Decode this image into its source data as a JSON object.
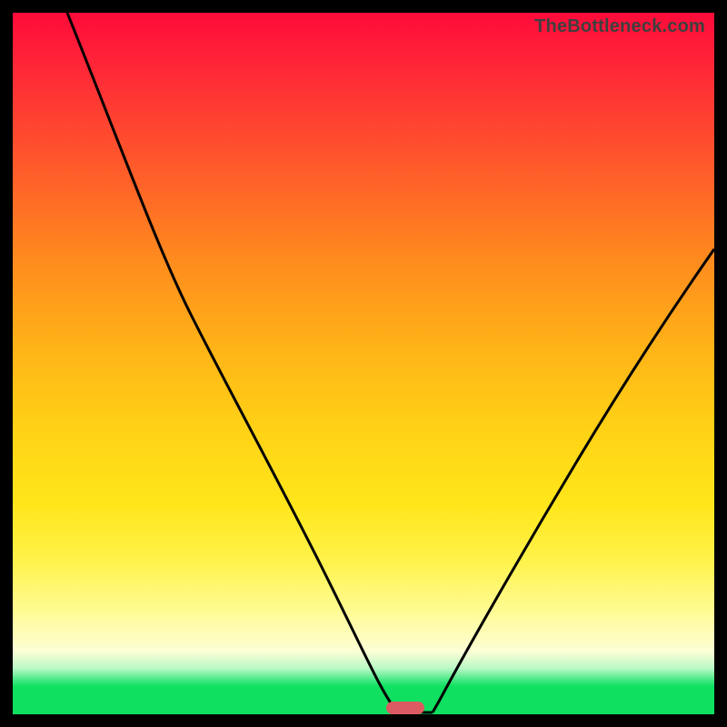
{
  "watermark": "TheBottleneck.com",
  "colors": {
    "frame": "#000000",
    "marker": "#dc5a61",
    "curve": "#000000"
  },
  "chart_data": {
    "type": "line",
    "title": "",
    "xlabel": "",
    "ylabel": "",
    "xlim": [
      0,
      100
    ],
    "ylim": [
      0,
      100
    ],
    "x": [
      0,
      5,
      10,
      15,
      20,
      25,
      30,
      35,
      40,
      45,
      50,
      52,
      55,
      58,
      60,
      65,
      70,
      75,
      80,
      85,
      90,
      95,
      100
    ],
    "values": [
      100,
      93,
      85,
      77,
      70,
      64,
      55,
      45,
      35,
      24,
      12,
      4,
      0,
      0,
      4,
      15,
      26,
      37,
      47,
      55,
      60,
      64,
      67
    ],
    "series_name": "bottleneck_percent",
    "marker_position_x": 56,
    "marker_position_y": 0
  }
}
